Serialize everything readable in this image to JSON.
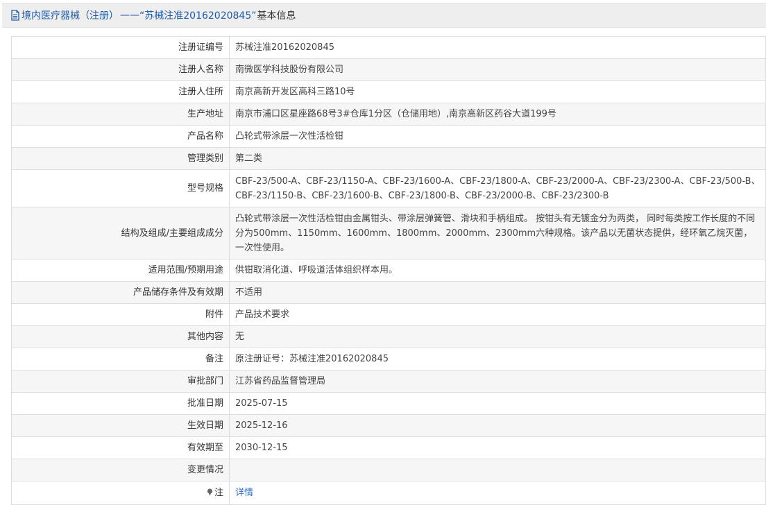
{
  "header": {
    "title_prefix": "境内医疗器械（注册）",
    "title_sep": "——",
    "title_quoted": "“苏械注准20162020845”",
    "title_suffix": "基本信息"
  },
  "rows": [
    {
      "label": "注册证编号",
      "value": "苏械注准20162020845"
    },
    {
      "label": "注册人名称",
      "value": "南微医学科技股份有限公司"
    },
    {
      "label": "注册人住所",
      "value": "南京高新开发区高科三路10号"
    },
    {
      "label": "生产地址",
      "value": "南京市浦口区星座路68号3#仓库1分区（仓储用地）,南京高新区药谷大道199号"
    },
    {
      "label": "产品名称",
      "value": "凸轮式带涂层一次性活检钳"
    },
    {
      "label": "管理类别",
      "value": "第二类"
    },
    {
      "label": "型号规格",
      "value": "CBF-23/500-A、CBF-23/1150-A、CBF-23/1600-A、CBF-23/1800-A、CBF-23/2000-A、CBF-23/2300-A、CBF-23/500-B、CBF-23/1150-B、CBF-23/1600-B、CBF-23/1800-B、CBF-23/2000-B、CBF-23/2300-B"
    },
    {
      "label": "结构及组成/主要组成成分",
      "value": "凸轮式带涂层一次性活检钳由金属钳头、带涂层弹簧管、滑块和手柄组成。 按钳头有无镀金分为两类， 同时每类按工作长度的不同分为500mm、1150mm、1600mm、1800mm、2000mm、2300mm六种规格。该产品以无菌状态提供，经环氧乙烷灭菌，一次性使用。"
    },
    {
      "label": "适用范围/预期用途",
      "value": "供钳取消化道、呼吸道活体组织样本用。"
    },
    {
      "label": "产品储存条件及有效期",
      "value": "不适用"
    },
    {
      "label": "附件",
      "value": "产品技术要求"
    },
    {
      "label": "其他内容",
      "value": "无"
    },
    {
      "label": "备注",
      "value": "原注册证号：苏械注准20162020845"
    },
    {
      "label": "审批部门",
      "value": "江苏省药品监督管理局"
    },
    {
      "label": "批准日期",
      "value": "2025-07-15"
    },
    {
      "label": "生效日期",
      "value": "2025-12-16"
    },
    {
      "label": "有效期至",
      "value": "2030-12-15"
    },
    {
      "label": "变更情况",
      "value": ""
    }
  ],
  "note_row": {
    "label": "注",
    "link": "详情"
  },
  "icons": {
    "title": "document-icon",
    "note": "pin-icon"
  },
  "colors": {
    "title_text": "#1e5aa8",
    "link": "#2a6bbf",
    "header_bg": "#eeeeee",
    "stripe": "#f6f6f6",
    "border": "#dddddd"
  }
}
